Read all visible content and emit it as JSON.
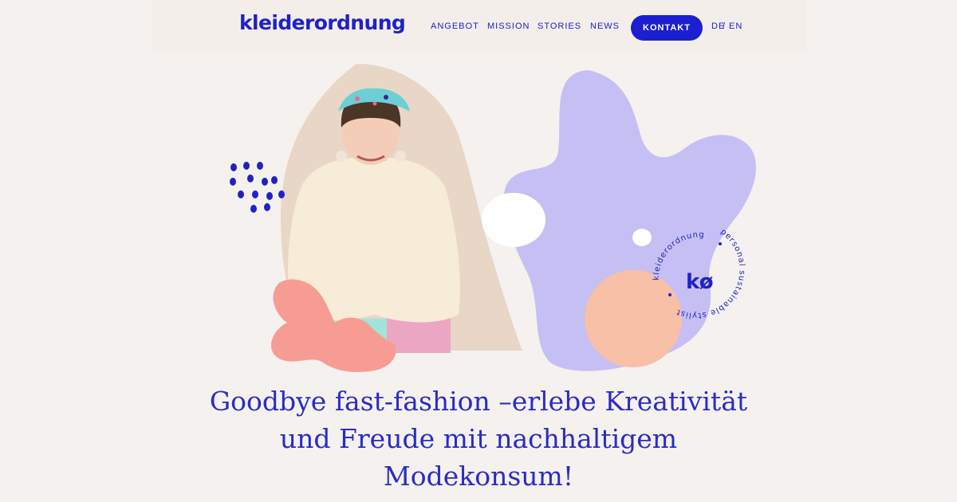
{
  "header": {
    "logo": "kleiderordnung",
    "nav": {
      "angebot": "ANGEBOT",
      "mission": "MISSION",
      "stories": "STORIES",
      "news": "NEWS"
    },
    "contact_label": "KONTAKT",
    "lang": {
      "de": "DE",
      "separator": "/",
      "en": "EN"
    }
  },
  "badge": {
    "ring_text_top": "kleiderordnung",
    "ring_text_bottom": "personal sustainable stylist",
    "monogram": "kø"
  },
  "hero": {
    "headline_line1": "Goodbye fast-fashion –erlebe Kreativität",
    "headline_line2": "und Freude mit nachhaltigem",
    "headline_line3": "Modekonsum!"
  },
  "colors": {
    "brand_blue": "#1f22c8",
    "lavender": "#c6bff3",
    "coral": "#f79c93",
    "peach": "#f8c0a6",
    "background": "#f5f1ee"
  }
}
